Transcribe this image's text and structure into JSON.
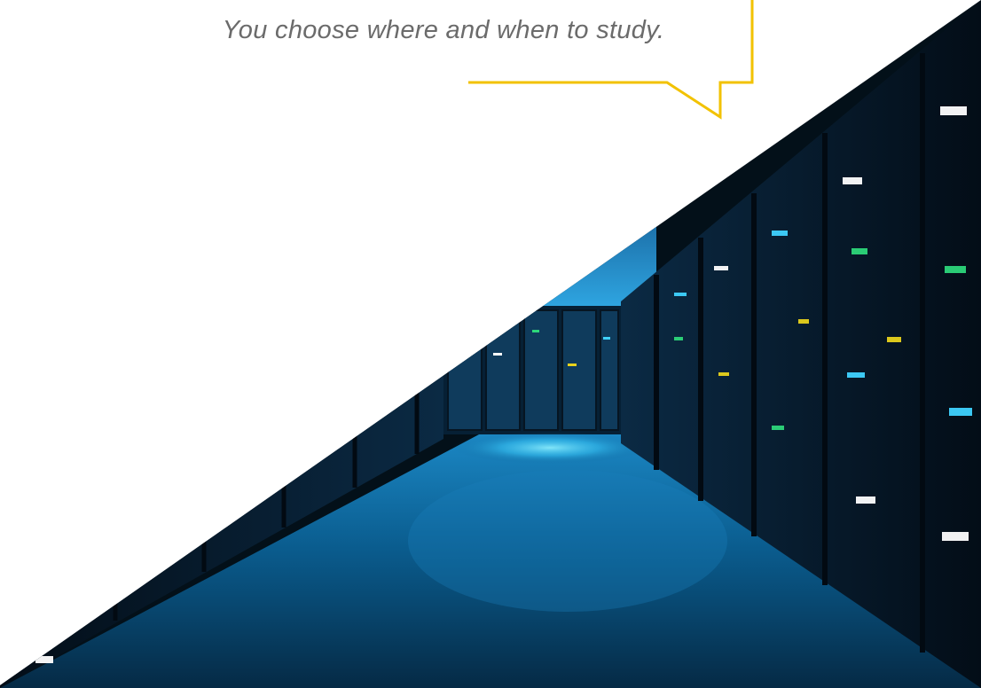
{
  "speech_bubble": {
    "text": "You choose where and when to study.",
    "border_color": "#f2c200"
  },
  "hero_image": {
    "subject": "server-room-corridor",
    "colors": {
      "dark": "#031019",
      "deep_blue": "#06314f",
      "glow": "#3fd2ff",
      "floor": "#0a5c8e"
    }
  }
}
